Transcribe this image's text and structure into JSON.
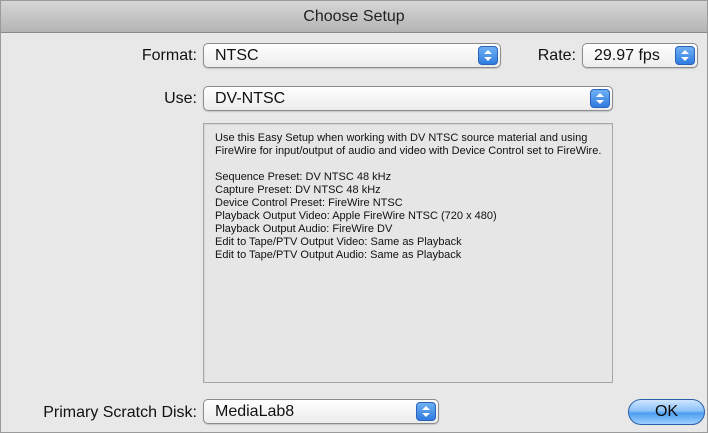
{
  "window": {
    "title": "Choose Setup"
  },
  "format": {
    "label": "Format:",
    "value": "NTSC"
  },
  "rate": {
    "label": "Rate:",
    "value": "29.97 fps"
  },
  "use": {
    "label": "Use:",
    "value": "DV-NTSC"
  },
  "description": {
    "intro": [
      "Use this Easy Setup when working with DV NTSC source material and using",
      "FireWire for input/output of audio and video with Device Control set to FireWire."
    ],
    "details": [
      "Sequence Preset: DV NTSC 48 kHz",
      "Capture Preset: DV NTSC 48 kHz",
      "Device Control Preset: FireWire NTSC",
      "Playback Output Video: Apple FireWire NTSC (720 x 480)",
      "Playback Output Audio: FireWire DV",
      "Edit to Tape/PTV Output Video: Same as Playback",
      "Edit to Tape/PTV Output Audio: Same as Playback"
    ]
  },
  "scratch_disk": {
    "label": "Primary Scratch Disk:",
    "value": "MediaLab8"
  },
  "buttons": {
    "ok": "OK"
  },
  "icons": {
    "popup_arrows": "up-down-chevron-icon"
  },
  "colors": {
    "accent_blue": "#2f7be0",
    "ok_button": "#6aaef5"
  }
}
